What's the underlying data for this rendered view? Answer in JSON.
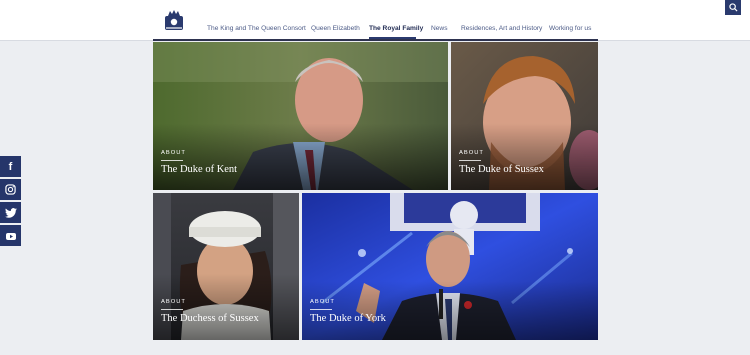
{
  "header": {
    "nav": [
      {
        "label": "The King and The Queen Consort"
      },
      {
        "label": "Queen Elizabeth"
      },
      {
        "label": "The Royal Family"
      },
      {
        "label": "News"
      },
      {
        "label": "Residences, Art and History"
      },
      {
        "label": "Working for us"
      }
    ],
    "active_nav": "The Royal Family",
    "logo_icon": "royal-crest-icon",
    "search_icon": "search-icon",
    "accent_color": "#2a3a6e"
  },
  "social": [
    {
      "icon": "facebook-icon",
      "glyph": "f"
    },
    {
      "icon": "instagram-icon",
      "glyph": "◎"
    },
    {
      "icon": "twitter-icon",
      "glyph": "t"
    },
    {
      "icon": "youtube-icon",
      "glyph": "▶"
    }
  ],
  "tiles": [
    {
      "kicker": "ABOUT",
      "title": "The Duke of Kent"
    },
    {
      "kicker": "ABOUT",
      "title": "The Duke of Sussex"
    },
    {
      "kicker": "ABOUT",
      "title": "The Duchess of Sussex"
    },
    {
      "kicker": "ABOUT",
      "title": "The Duke of York"
    }
  ]
}
